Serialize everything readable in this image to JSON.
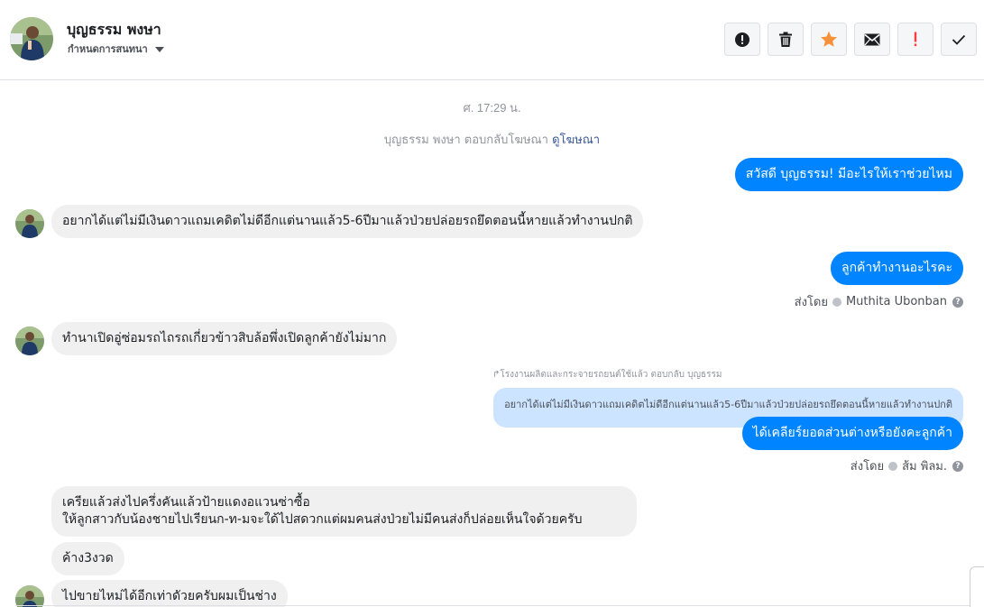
{
  "header": {
    "contact_name": "บุญธรรม พงษา",
    "assign_label": "กำหนดการสนทนา",
    "actions": [
      {
        "name": "mark-spam-button",
        "icon": "alert-circle-icon",
        "color": "#1c1e21"
      },
      {
        "name": "delete-button",
        "icon": "trash-icon",
        "color": "#1c1e21"
      },
      {
        "name": "star-button",
        "icon": "star-icon",
        "color": "#f7923b"
      },
      {
        "name": "mark-unread-button",
        "icon": "envelope-icon",
        "color": "#1c1e21"
      },
      {
        "name": "follow-up-button",
        "icon": "exclamation-icon",
        "color": "#fa3e3e"
      },
      {
        "name": "mark-done-button",
        "icon": "checkmark-icon",
        "color": "#1c1e21"
      }
    ]
  },
  "thread": {
    "timestamp": "ศ. 17:29 น.",
    "system_message": "บุญธรรม พงษา ตอบกลับโฆษณา",
    "system_link": "ดูโฆษณา",
    "messages": [
      {
        "dir": "out",
        "text": "สวัสดี บุญธรรม! มีอะไรให้เราช่วยไหม"
      },
      {
        "dir": "in",
        "text": "อยากได้แต่ไม่มีเงินดาวแถมเคดิตไม่ดีอีกแต่นานแล้ว5-6ปีมาแล้วป่วยปล่อยรถยึดตอนนี้หายแล้วทำงานปกติ"
      },
      {
        "dir": "out",
        "text": "ลูกค้าทำงานอะไรคะ"
      },
      {
        "dir": "sentby",
        "label": "ส่งโดย",
        "name": "Muthita Ubonban"
      },
      {
        "dir": "in",
        "text": "ทำนาเปิดอู่ซ่อมรถไถรถเกี่ยวข้าวสิบล้อพึ่งเปิดลูกค้ายังไม่มาก"
      },
      {
        "dir": "reply_header",
        "text": "โรงงานผลิตและกระจายรถยนต์ใช้แล้ว ตอบกลับ บุญธรรม"
      },
      {
        "dir": "reply_quote",
        "text": "อยากได้แต่ไม่มีเงินดาวแถมเคดิตไม่ดีอีกแต่นานแล้ว5-6ปีมาแล้วป่วยปล่อยรถยึดตอนนี้หายแล้วทำงานปกติ"
      },
      {
        "dir": "out",
        "text": "ได้เคลียร์ยอดส่วนต่างหรือยังคะลูกค้า"
      },
      {
        "dir": "sentby",
        "label": "ส่งโดย",
        "name": "ส้ม พิลม."
      },
      {
        "dir": "in",
        "line1": "เครียแล้วส่งไปครึ่งคันแล้วป้ายแดงอแวนซ่าซื้อ",
        "line2": "ให้ลูกสาวกับน้องชายไปเรียนก-ท-มจะใด้ไปสดวกแต่ผมคนส่งป่วยไม่มีคนส่งก็ปล่อยเห็นใจด้วยครับ"
      },
      {
        "dir": "in",
        "text": "ค้าง3งวด"
      },
      {
        "dir": "in",
        "text": "ไปขายไหม่ได้อีกเท่าดัวยครับผมเป็นช่าง"
      }
    ]
  },
  "colors": {
    "outgoing": "#0084ff",
    "incoming": "#f1f0f0",
    "reply_quote": "#cce4ff",
    "link": "#385898"
  }
}
